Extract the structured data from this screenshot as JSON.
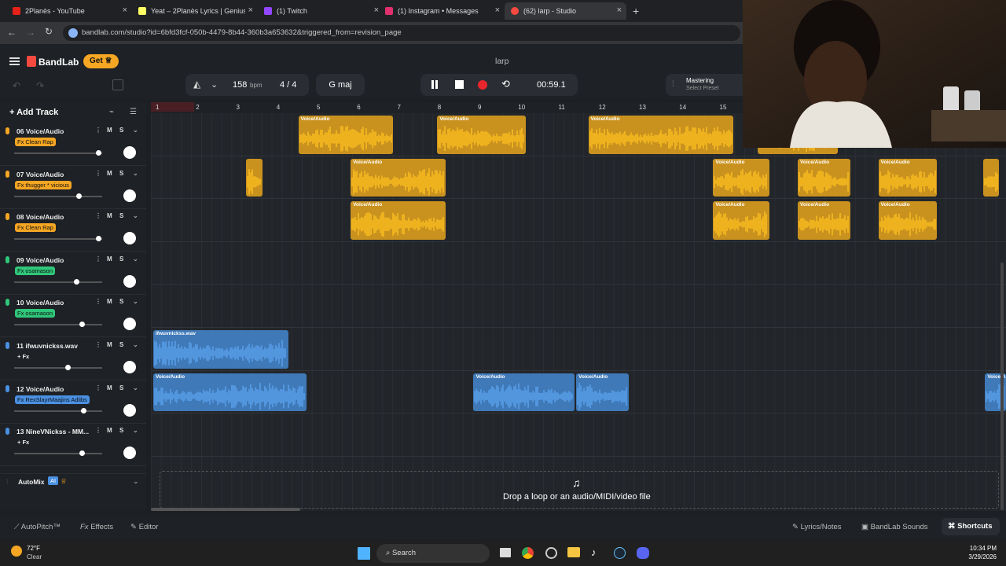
{
  "browser": {
    "tabs": [
      {
        "title": "2Planès - YouTube",
        "color": "#e62117"
      },
      {
        "title": "Yeat – 2Planès Lyrics | Genius Ly",
        "color": "#ffff64"
      },
      {
        "title": "(1) Twitch",
        "color": "#9146ff"
      },
      {
        "title": "(1) Instagram • Messages",
        "color": "#e1306c"
      },
      {
        "title": "(62) larp - Studio",
        "color": "#f54a3f"
      }
    ],
    "url": "bandlab.com/studio?id=6bfd3fcf-050b-4479-8b44-360b3a653632&triggered_from=revision_page"
  },
  "app": {
    "brand": "BandLab",
    "get_label": "Get",
    "project_title": "larp",
    "tempo": "158",
    "tempo_unit": "bpm",
    "time_sig": "4 / 4",
    "key": "G maj",
    "time": "00:59.1",
    "mastering_label": "Mastering",
    "mastering_preset": "Select Preset",
    "add_track": "Add Track",
    "automix": "AutoMix",
    "automix_badge": "AI"
  },
  "ruler": [
    "1",
    "2",
    "3",
    "4",
    "5",
    "6",
    "7",
    "8",
    "9",
    "10",
    "11",
    "12",
    "13",
    "14",
    "15"
  ],
  "tracks": [
    {
      "num": "06",
      "name": "Voice/Audio",
      "fx": "Fx Clean Rap",
      "fxcolor": "#f5a623",
      "iconcolor": "#f5a623",
      "level": 0.96
    },
    {
      "num": "07",
      "name": "Voice/Audio",
      "fx": "Fx thugger * vicious",
      "fxcolor": "#f5a623",
      "iconcolor": "#f5a623",
      "level": 0.73
    },
    {
      "num": "08",
      "name": "Voice/Audio",
      "fx": "Fx Clean Rap",
      "fxcolor": "#f5a623",
      "iconcolor": "#f5a623",
      "level": 0.96
    },
    {
      "num": "09",
      "name": "Voice/Audio",
      "fx": "Fx osamason",
      "fxcolor": "#2fc77a",
      "iconcolor": "#2fc77a",
      "level": 0.7
    },
    {
      "num": "10",
      "name": "Voice/Audio",
      "fx": "Fx osamason",
      "fxcolor": "#2fc77a",
      "iconcolor": "#2fc77a",
      "level": 0.77
    },
    {
      "num": "11",
      "name": "ifwuvnickss.wav",
      "fx": "+ Fx",
      "fxcolor": "",
      "iconcolor": "#4a90e2",
      "level": 0.6
    },
    {
      "num": "12",
      "name": "Voice/Audio",
      "fx": "Fx RexSlayrMaajins Adlibs",
      "fxcolor": "#4a90e2",
      "iconcolor": "#4a90e2",
      "level": 0.79
    },
    {
      "num": "13",
      "name": "NineVNickss - MM...",
      "fx": "+ Fx",
      "fxcolor": "",
      "iconcolor": "#4a90e2",
      "level": 0.77
    }
  ],
  "clips": [
    {
      "lane": 0,
      "start": 3.6,
      "len": 2.35,
      "label": "Voice/Audio",
      "color": "#c9921f"
    },
    {
      "lane": 0,
      "start": 7.05,
      "len": 2.2,
      "label": "Voice/Audio",
      "color": "#c9921f"
    },
    {
      "lane": 0,
      "start": 10.8,
      "len": 3.6,
      "label": "Voice/Audio",
      "color": "#c9921f"
    },
    {
      "lane": 0,
      "start": 15.0,
      "len": 2.0,
      "label": "",
      "color": "#c9921f"
    },
    {
      "lane": 1,
      "start": 2.3,
      "len": 0.42,
      "label": "",
      "color": "#c9921f"
    },
    {
      "lane": 1,
      "start": 4.9,
      "len": 2.35,
      "label": "Voice/Audio",
      "color": "#c9921f"
    },
    {
      "lane": 1,
      "start": 13.9,
      "len": 1.4,
      "label": "Voice/Audio",
      "color": "#c9921f"
    },
    {
      "lane": 1,
      "start": 16.0,
      "len": 1.3,
      "label": "Voice/Audio",
      "color": "#c9921f"
    },
    {
      "lane": 1,
      "start": 18.0,
      "len": 1.45,
      "label": "Voice/Audio",
      "color": "#c9921f"
    },
    {
      "lane": 1,
      "start": 20.6,
      "len": 0.4,
      "label": "",
      "color": "#c9921f"
    },
    {
      "lane": 2,
      "start": 4.9,
      "len": 2.35,
      "label": "Voice/Audio",
      "color": "#c9921f"
    },
    {
      "lane": 2,
      "start": 13.9,
      "len": 1.4,
      "label": "Voice/Audio",
      "color": "#c9921f"
    },
    {
      "lane": 2,
      "start": 16.0,
      "len": 1.3,
      "label": "Voice/Audio",
      "color": "#c9921f"
    },
    {
      "lane": 2,
      "start": 18.0,
      "len": 1.45,
      "label": "Voice/Audio",
      "color": "#c9921f"
    },
    {
      "lane": 5,
      "start": 0.0,
      "len": 3.35,
      "label": "ifwuvnickss.wav",
      "color": "#3f79b8"
    },
    {
      "lane": 6,
      "start": 0.0,
      "len": 3.8,
      "label": "Voice/Audio",
      "color": "#3f79b8"
    },
    {
      "lane": 6,
      "start": 7.95,
      "len": 2.5,
      "label": "Voice/Audio",
      "color": "#3f79b8"
    },
    {
      "lane": 6,
      "start": 10.5,
      "len": 1.3,
      "label": "Voice/Audio",
      "color": "#3f79b8"
    },
    {
      "lane": 6,
      "start": 20.65,
      "len": 1.0,
      "label": "Voice/Audio",
      "color": "#3f79b8"
    }
  ],
  "dropzone": "Drop a loop or an audio/MIDI/video file",
  "bottom": {
    "autopitch": "AutoPitch™",
    "effects": "Effects",
    "editor": "Editor",
    "lyrics": "Lyrics/Notes",
    "sounds": "BandLab Sounds",
    "shortcuts": "Shortcuts"
  },
  "taskbar": {
    "temp": "72°F",
    "weather": "Clear",
    "search": "Search",
    "time": "10:34 PM",
    "date": "3/29/2026"
  }
}
